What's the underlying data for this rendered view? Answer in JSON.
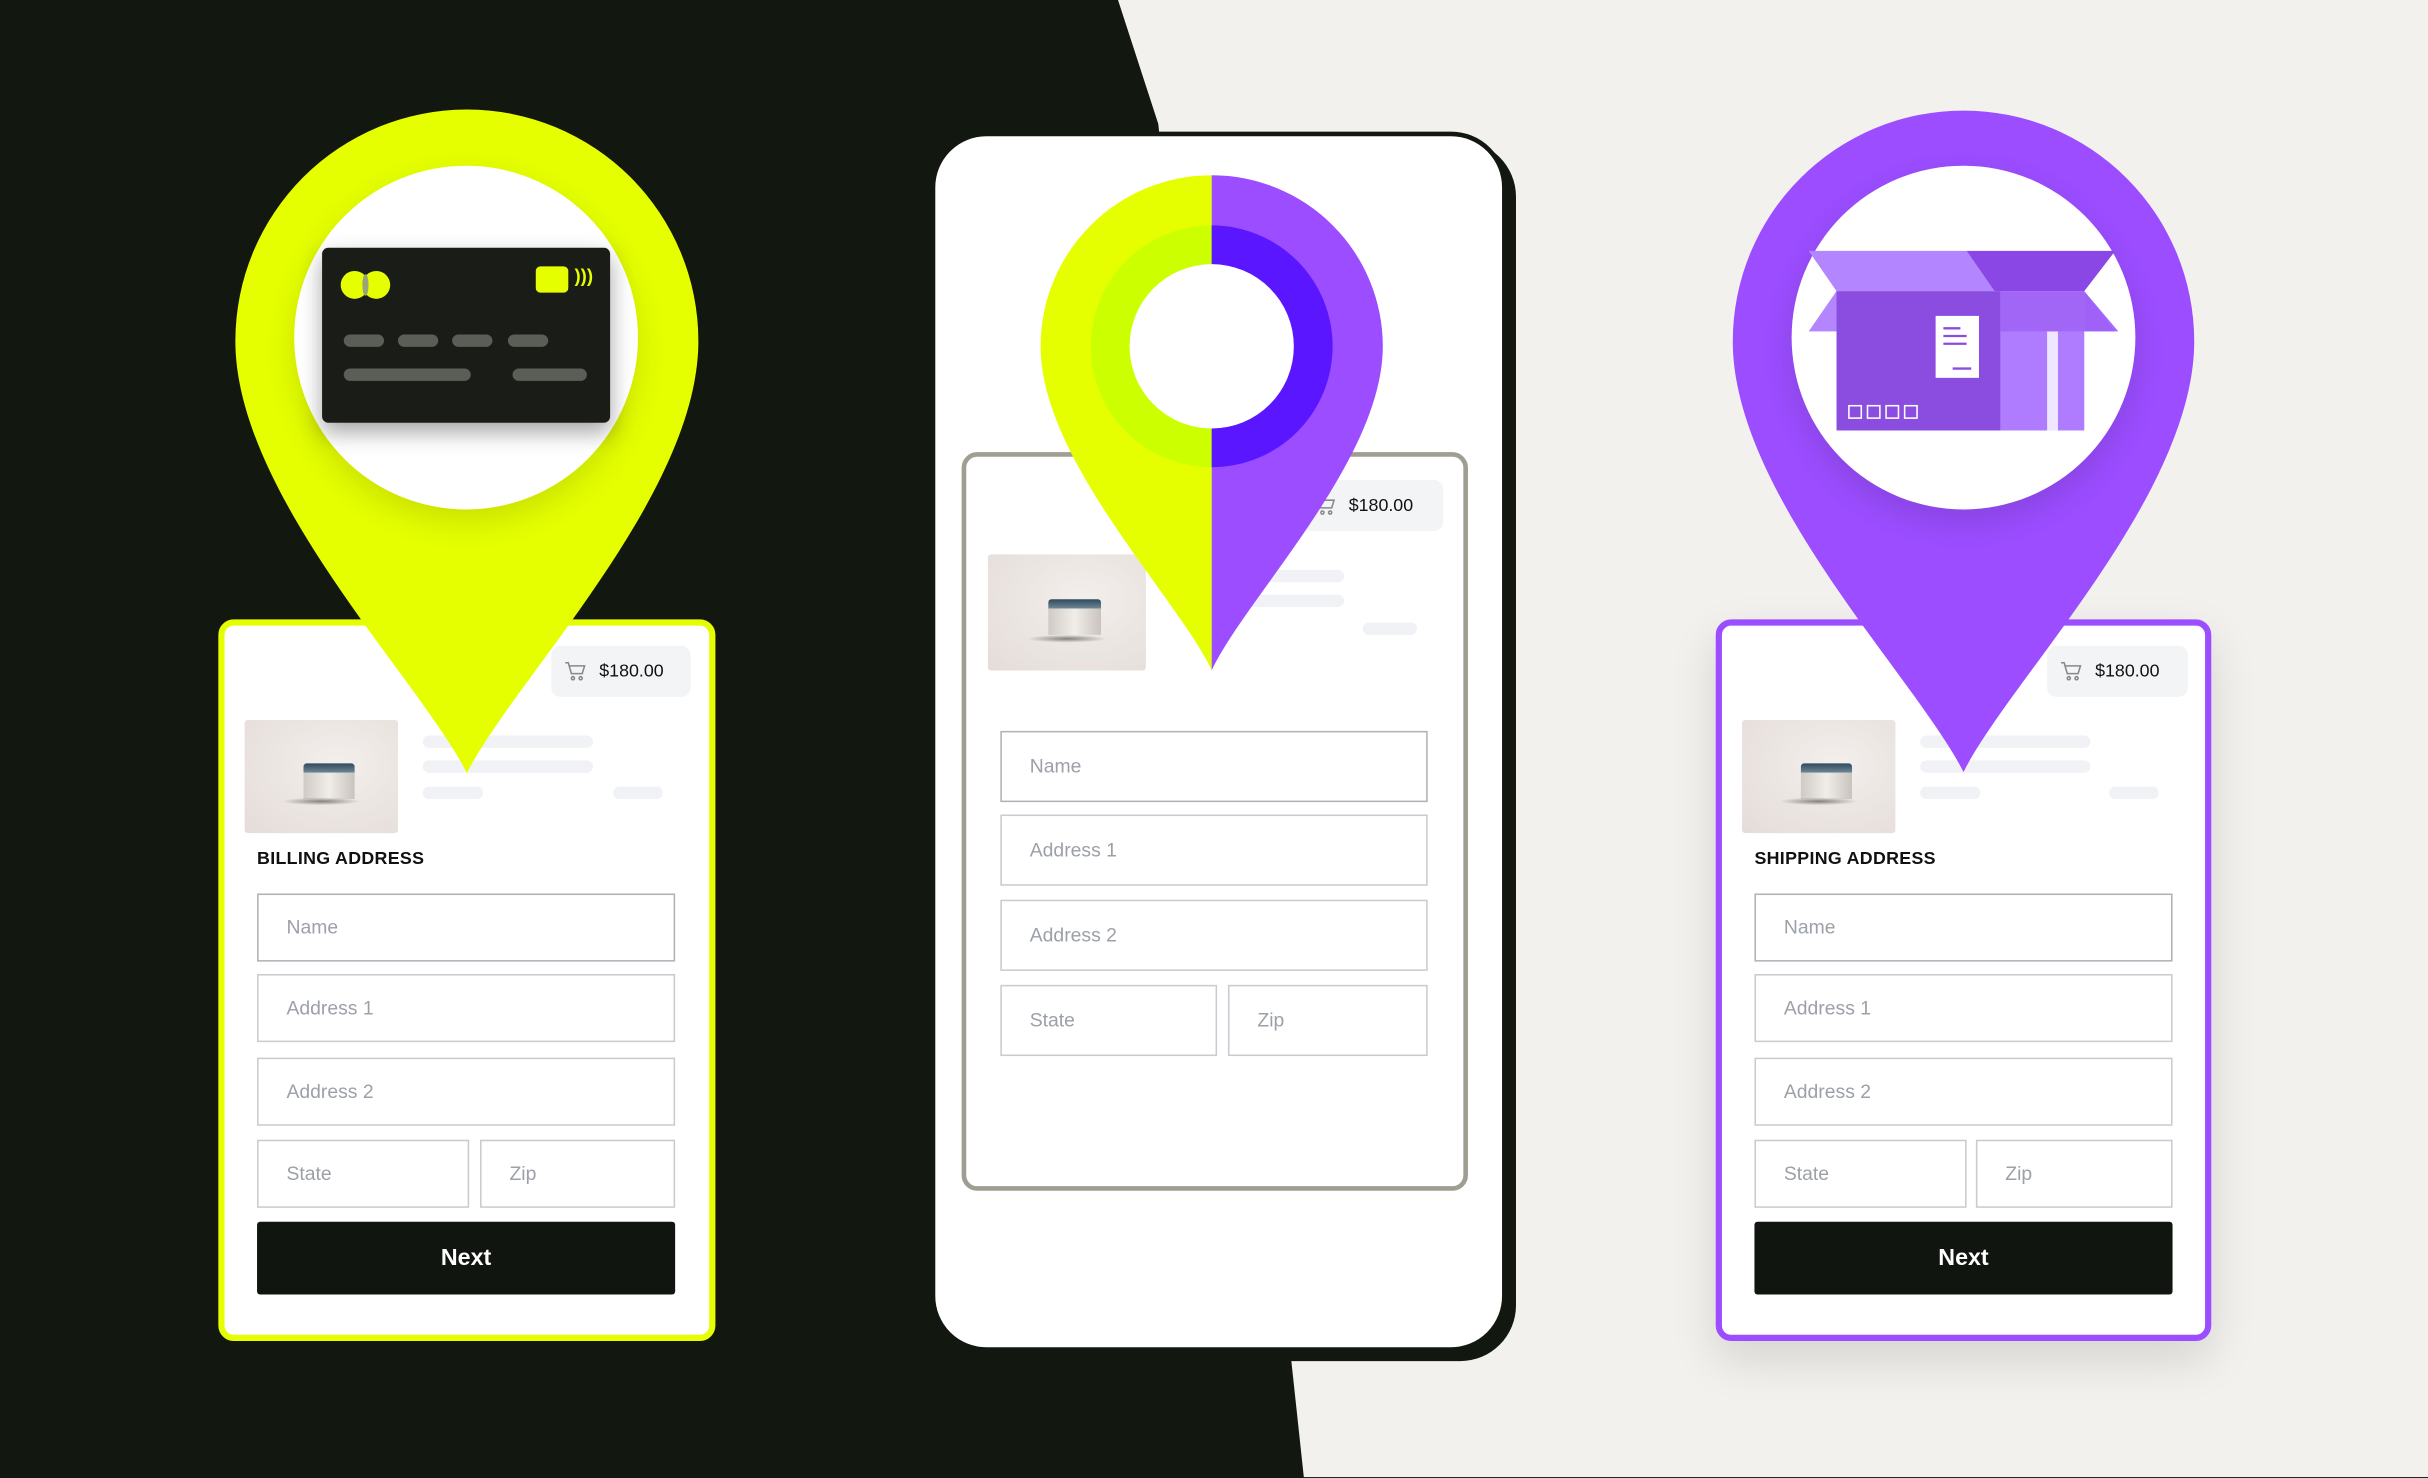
{
  "colors": {
    "dark_bg": "#121810",
    "light_bg": "#f2f1ed",
    "yellow": "#e5ff00",
    "purple": "#9b4dff",
    "lime_ring": "#ccff00",
    "violet_ring": "#5a17ff",
    "button": "#111510"
  },
  "left_card": {
    "cart_total": "$180.00",
    "section_title": "BILLING ADDRESS",
    "fields": {
      "name": "Name",
      "address1": "Address 1",
      "address2": "Address 2",
      "state": "State",
      "zip": "Zip"
    },
    "next_label": "Next",
    "pin_icon": "credit-card-icon"
  },
  "center_phone": {
    "cart_total": "$180.00",
    "fields": {
      "name": "Name",
      "address1": "Address 1",
      "address2": "Address 2",
      "state": "State",
      "zip": "Zip"
    },
    "pin_icon": "location-pin-icon"
  },
  "right_card": {
    "cart_total": "$180.00",
    "section_title": "SHIPPING ADDRESS",
    "fields": {
      "name": "Name",
      "address1": "Address 1",
      "address2": "Address 2",
      "state": "State",
      "zip": "Zip"
    },
    "next_label": "Next",
    "pin_icon": "package-box-icon"
  }
}
